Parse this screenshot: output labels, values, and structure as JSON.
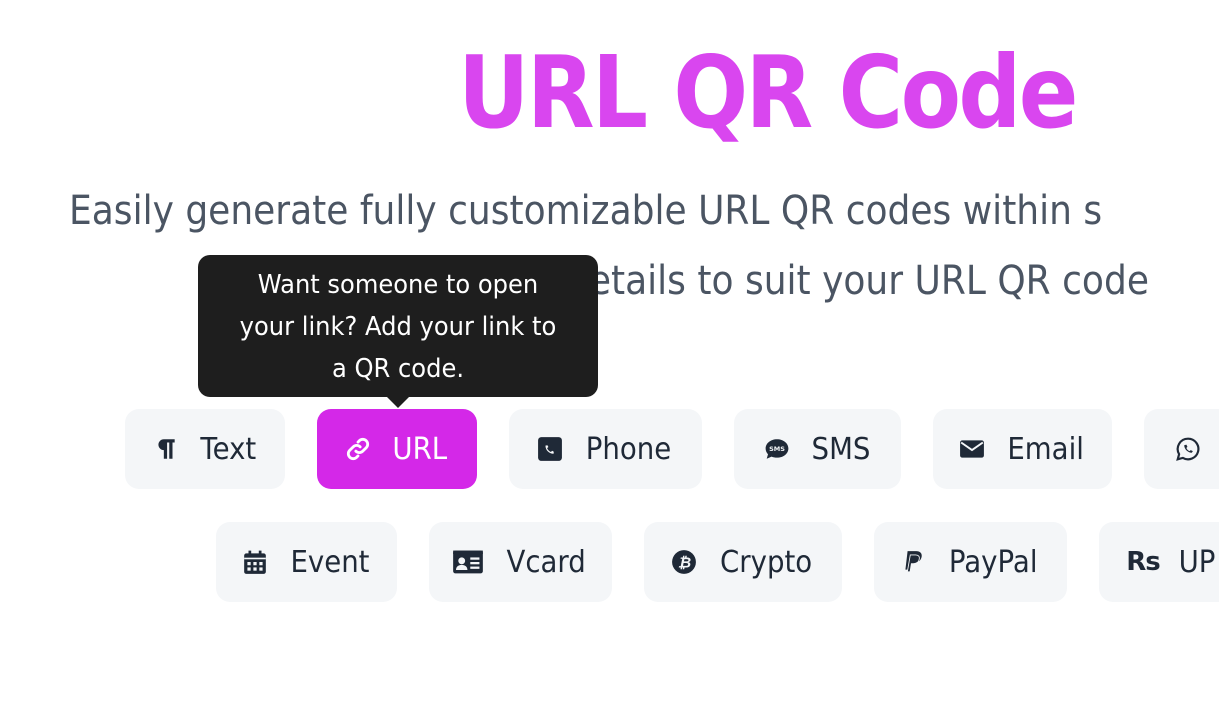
{
  "header": {
    "title": "URL QR Code",
    "subtitle_line1": "Easily generate fully customizable URL QR codes within s",
    "subtitle_line2": "details to suit your URL QR code"
  },
  "tooltip": {
    "text": "Want someone to open your link? Add your link to a QR code."
  },
  "colors": {
    "accent": "#d946ef",
    "active_tab": "#d428e8",
    "tab_bg": "#f4f6f8",
    "tooltip_bg": "#1e1e1e",
    "subtitle": "#4b5563"
  },
  "tabs_row1": [
    {
      "label": "Text",
      "icon": "paragraph-icon",
      "active": false
    },
    {
      "label": "URL",
      "icon": "link-icon",
      "active": true
    },
    {
      "label": "Phone",
      "icon": "phone-icon",
      "active": false
    },
    {
      "label": "SMS",
      "icon": "sms-icon",
      "active": false
    },
    {
      "label": "Email",
      "icon": "envelope-icon",
      "active": false
    },
    {
      "label": "",
      "icon": "whatsapp-icon",
      "active": false
    }
  ],
  "tabs_row2": [
    {
      "label": "Event",
      "icon": "calendar-icon",
      "active": false
    },
    {
      "label": "Vcard",
      "icon": "id-card-icon",
      "active": false
    },
    {
      "label": "Crypto",
      "icon": "bitcoin-icon",
      "active": false
    },
    {
      "label": "PayPal",
      "icon": "paypal-icon",
      "active": false
    },
    {
      "label": "UP",
      "icon": "rupee-icon",
      "icon_text": "Rs",
      "active": false
    }
  ]
}
